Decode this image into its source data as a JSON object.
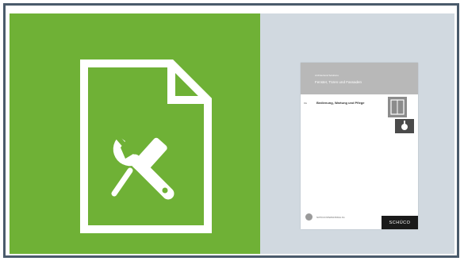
{
  "colors": {
    "frame": "#4a5b6b",
    "green_panel": "#6fb136",
    "gray_panel": "#d1d9e0",
    "icon_stroke": "#ffffff"
  },
  "icons": {
    "main": "document-with-wrench-and-screwdriver-icon"
  },
  "catalog": {
    "brand_line": "Architectural Solutions",
    "title": "Fenster, Türen und Fassaden",
    "code": "DE",
    "subtitle": "Bedienung, Wartung und Pflege",
    "footer_text": "SCHÜCO INTERNATIONAL KG",
    "brand": "SCHÜCO"
  }
}
